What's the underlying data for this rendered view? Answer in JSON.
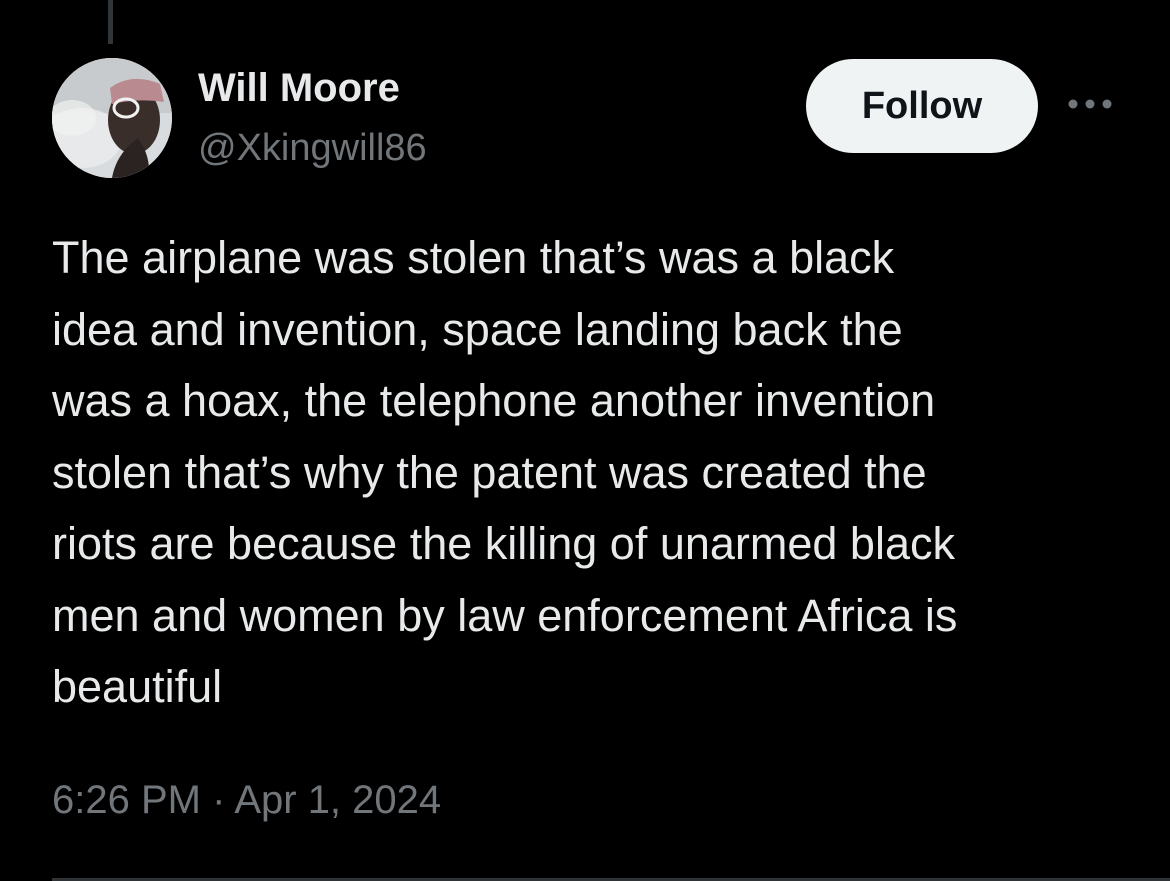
{
  "author": {
    "display_name": "Will Moore",
    "handle": "@Xkingwill86"
  },
  "actions": {
    "follow_label": "Follow",
    "more_icon": "more-horizontal-icon"
  },
  "tweet": {
    "text": "The airplane was stolen that’s was a black\nidea and invention, space landing back the\nwas a hoax, the telephone another invention\nstolen that’s why the patent was created the\nriots are because the killing of unarmed black\nmen and women by law enforcement Africa is\nbeautiful",
    "time": "6:26 PM",
    "separator": "·",
    "date": "Apr 1, 2024"
  },
  "colors": {
    "background": "#000000",
    "primary_text": "#e7e9ea",
    "secondary_text": "#71767b",
    "follow_bg": "#eff3f4",
    "follow_text": "#0f1419"
  }
}
